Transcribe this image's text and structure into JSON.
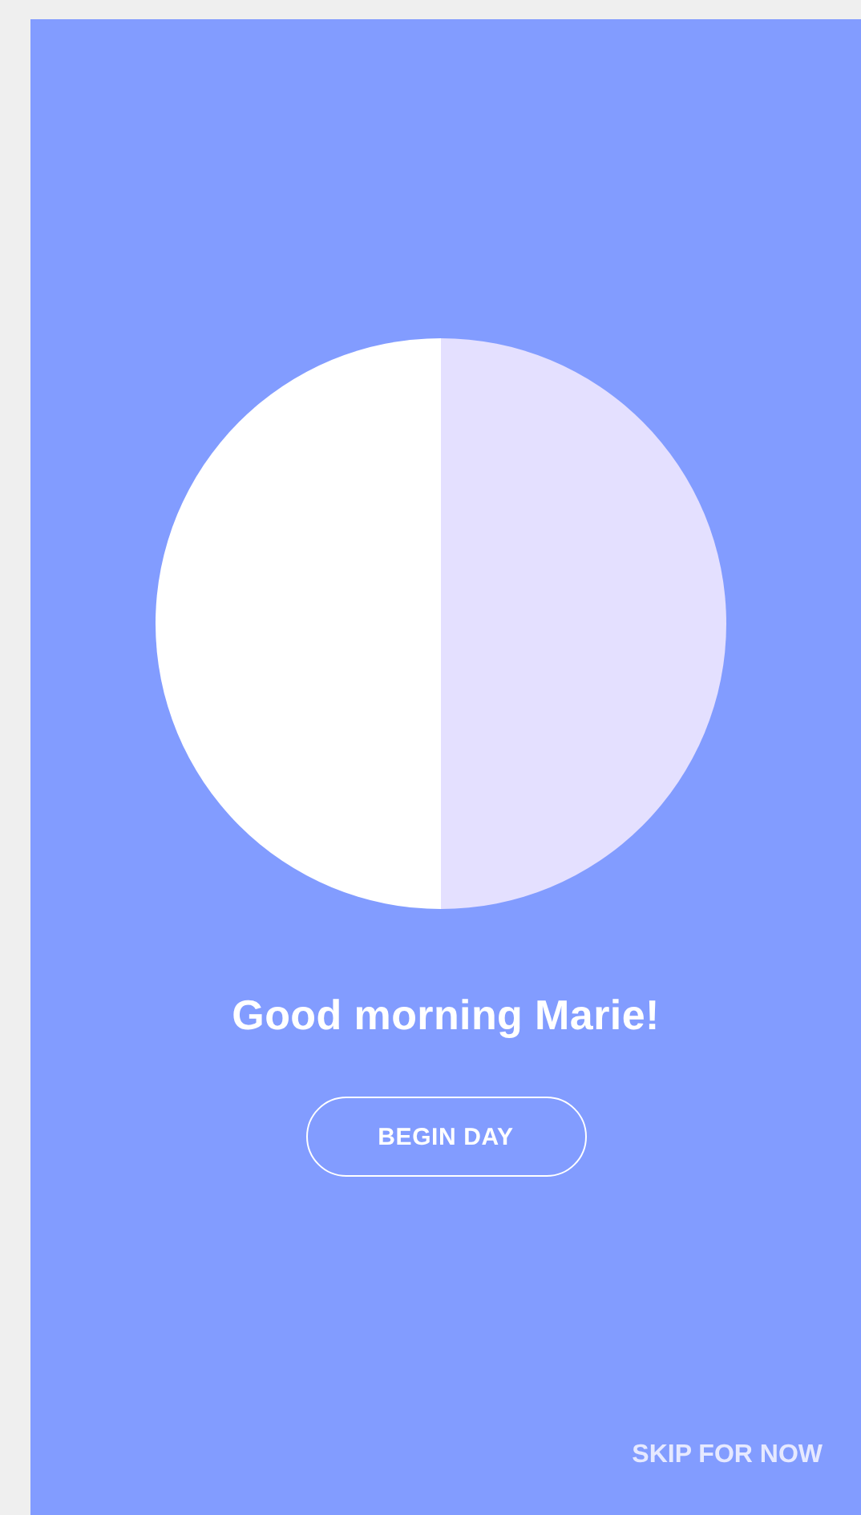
{
  "greeting": "Good morning Marie!",
  "begin_button": {
    "label": "BEGIN DAY"
  },
  "skip_link": {
    "label": "SKIP FOR NOW"
  }
}
